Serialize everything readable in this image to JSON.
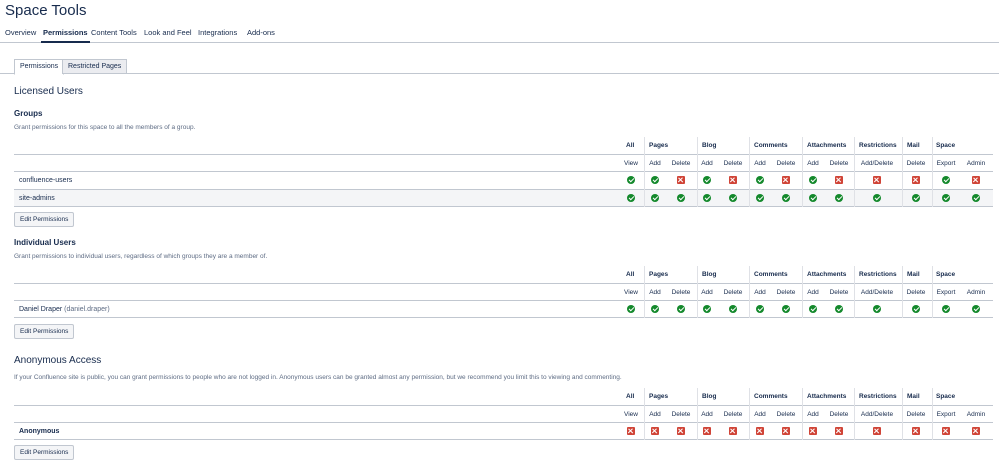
{
  "page_title": "Space Tools",
  "top_tabs": [
    {
      "label": "Overview",
      "active": false
    },
    {
      "label": "Permissions",
      "active": true
    },
    {
      "label": "Content Tools",
      "active": false
    },
    {
      "label": "Look and Feel",
      "active": false
    },
    {
      "label": "Integrations",
      "active": false
    },
    {
      "label": "Add-ons",
      "active": false
    }
  ],
  "sub_tabs": [
    {
      "label": "Permissions",
      "active": true
    },
    {
      "label": "Restricted Pages",
      "active": false
    }
  ],
  "columns": {
    "groups": [
      "All",
      "Pages",
      "Blog",
      "Comments",
      "Attachments",
      "Restrictions",
      "Mail",
      "Space"
    ],
    "subs": [
      "View",
      "Add",
      "Delete",
      "Add",
      "Delete",
      "Add",
      "Delete",
      "Add",
      "Delete",
      "Add/Delete",
      "Delete",
      "Export",
      "Admin"
    ]
  },
  "licensed": {
    "heading": "Licensed Users",
    "groups": {
      "heading": "Groups",
      "description": "Grant permissions for this space to all the members of a group.",
      "rows": [
        {
          "name": "confluence-users",
          "detail": "",
          "perms": [
            true,
            true,
            false,
            true,
            false,
            true,
            false,
            true,
            false,
            false,
            false,
            true,
            false
          ]
        },
        {
          "name": "site-admins",
          "detail": "",
          "perms": [
            true,
            true,
            true,
            true,
            true,
            true,
            true,
            true,
            true,
            true,
            true,
            true,
            true
          ]
        }
      ],
      "button": "Edit Permissions"
    },
    "individual": {
      "heading": "Individual Users",
      "description": "Grant permissions to individual users, regardless of which groups they are a member of.",
      "rows": [
        {
          "name": "Daniel Draper",
          "detail": "(daniel.draper)",
          "perms": [
            true,
            true,
            true,
            true,
            true,
            true,
            true,
            true,
            true,
            true,
            true,
            true,
            true
          ]
        }
      ],
      "button": "Edit Permissions"
    }
  },
  "anonymous": {
    "heading": "Anonymous Access",
    "description": "If your Confluence site is public, you can grant permissions to people who are not logged in. Anonymous users can be granted almost any permission, but we recommend you limit this to viewing and commenting.",
    "rows": [
      {
        "name": "Anonymous",
        "detail": "",
        "perms": [
          false,
          false,
          false,
          false,
          false,
          false,
          false,
          false,
          false,
          false,
          false,
          false,
          false
        ]
      }
    ],
    "button": "Edit Permissions"
  },
  "colors": {
    "granted": "#14892c",
    "denied": "#d04437"
  },
  "icons": {
    "granted": "check-circle-icon",
    "denied": "cross-square-icon"
  }
}
